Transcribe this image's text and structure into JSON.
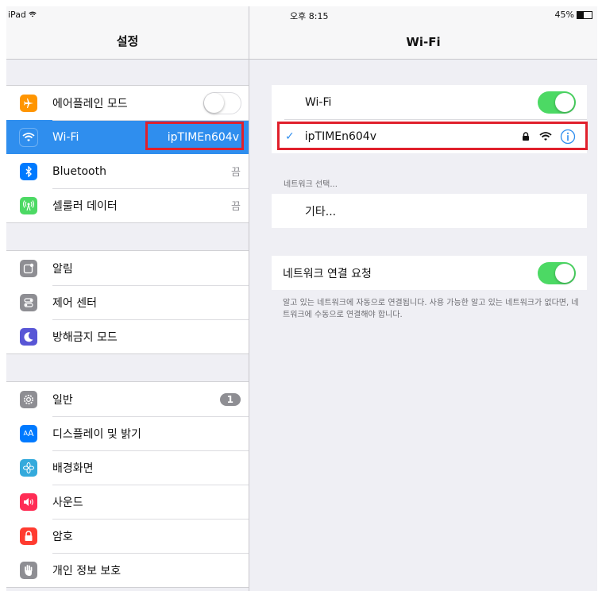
{
  "status": {
    "device": "iPad",
    "time": "오후 8:15",
    "battery": "45%",
    "battery_level": 0.45
  },
  "left": {
    "title": "설정",
    "groups": [
      [
        {
          "label": "에어플레인 모드",
          "icon": "airplane-icon",
          "color": "#ff9500"
        },
        {
          "label": "Wi-Fi",
          "value": "ipTIMEn604v",
          "icon": "wifi-icon",
          "color": "#2f8eee"
        },
        {
          "label": "Bluetooth",
          "value": "끔",
          "icon": "bluetooth-icon",
          "color": "#007aff"
        },
        {
          "label": "셀룰러 데이터",
          "value": "끔",
          "icon": "cellular-icon",
          "color": "#4cd964"
        }
      ],
      [
        {
          "label": "알림",
          "icon": "notifications-icon",
          "color": "#8e8e93"
        },
        {
          "label": "제어 센터",
          "icon": "control-center-icon",
          "color": "#8e8e93"
        },
        {
          "label": "방해금지 모드",
          "icon": "moon-icon",
          "color": "#5856d6"
        }
      ],
      [
        {
          "label": "일반",
          "badge": "1",
          "icon": "gear-icon",
          "color": "#8e8e93"
        },
        {
          "label": "디스플레이 및 밝기",
          "icon": "display-icon",
          "color": "#007aff"
        },
        {
          "label": "배경화면",
          "icon": "wallpaper-icon",
          "color": "#34aadc"
        },
        {
          "label": "사운드",
          "icon": "sound-icon",
          "color": "#ff2d55"
        },
        {
          "label": "암호",
          "icon": "lock-icon",
          "color": "#ff3b30"
        },
        {
          "label": "개인 정보 보호",
          "icon": "hand-icon",
          "color": "#8e8e93"
        }
      ]
    ]
  },
  "right": {
    "title": "Wi-Fi",
    "wifi_label": "Wi-Fi",
    "network_name": "ipTIMEn604v",
    "choose_header": "네트워크 선택...",
    "other_label": "기타...",
    "ask_label": "네트워크 연결 요청",
    "footnote": "알고 있는 네트워크에 자동으로 연결됩니다. 사용 가능한 알고 있는 네트워크가 없다면, 네트워크에 수동으로 연결해야 합니다."
  },
  "colors": {
    "accent": "#2f8eee",
    "toggle_on": "#4cd964",
    "highlight": "#e0202c"
  }
}
